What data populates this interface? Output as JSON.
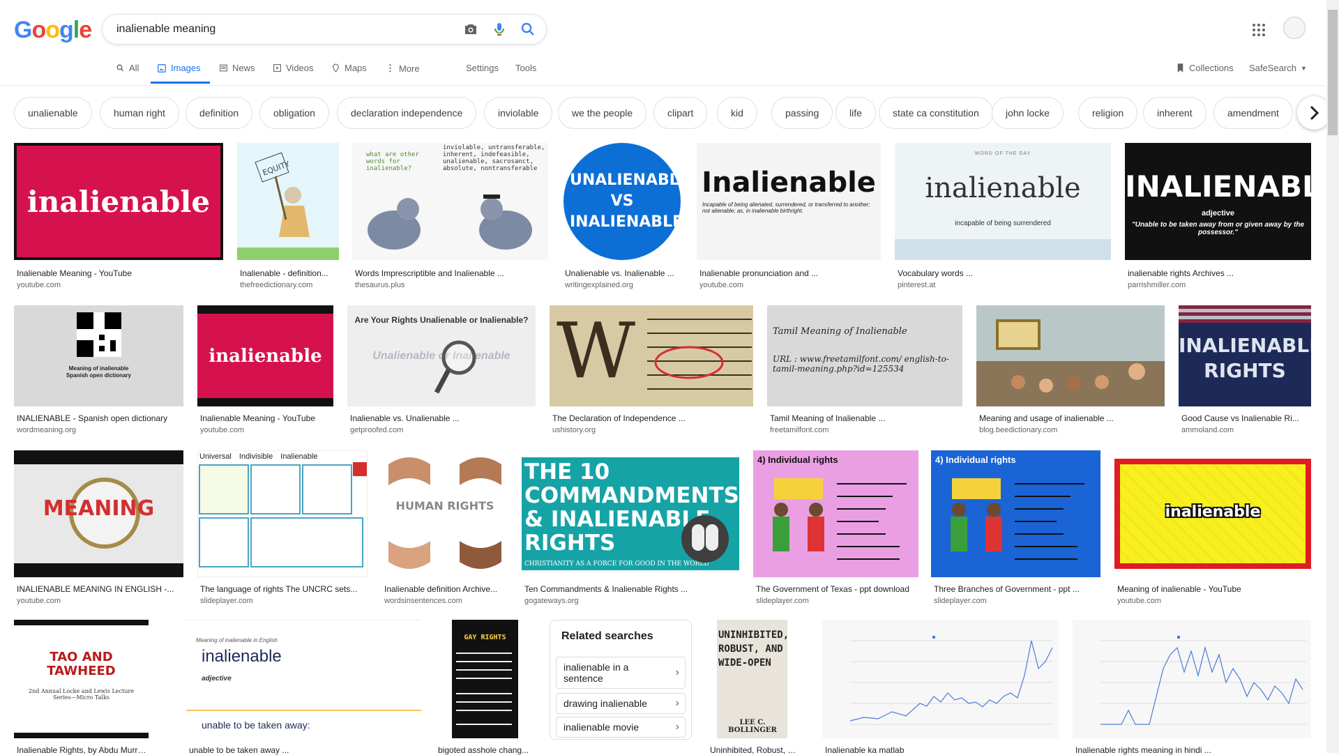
{
  "header": {
    "logo_letters": [
      "G",
      "o",
      "o",
      "g",
      "l",
      "e"
    ],
    "logo_colors": [
      "#4285f4",
      "#ea4335",
      "#fbbc05",
      "#4285f4",
      "#34a853",
      "#ea4335"
    ],
    "query": "inalienable meaning",
    "icons": [
      "camera-icon",
      "mic-icon",
      "search-icon",
      "apps-icon",
      "avatar"
    ]
  },
  "tabs": {
    "all": "All",
    "images": "Images",
    "news": "News",
    "videos": "Videos",
    "maps": "Maps",
    "more": "More",
    "settings": "Settings",
    "tools": "Tools",
    "collections": "Collections",
    "safesearch": "SafeSearch"
  },
  "chips": [
    "unalienable",
    "human right",
    "definition",
    "obligation",
    "declaration independence",
    "inviolable",
    "we the people",
    "clipart",
    "kid",
    "passing",
    "life",
    "state ca constitution",
    "john locke",
    "religion",
    "inherent",
    "amendment"
  ],
  "results": [
    {
      "caption": "Inalienable Meaning - YouTube",
      "source": "youtube.com",
      "thumb_text": "inalienable"
    },
    {
      "caption": "Inalienable - definition...",
      "source": "thefreedictionary.com",
      "thumb_text": "EQUITY"
    },
    {
      "caption": "Words Imprescriptible and Inalienable ...",
      "source": "thesaurus.plus",
      "thumb_text": "what are other words for inalienable?"
    },
    {
      "caption": "Unalienable vs. Inalienable ...",
      "source": "writingexplained.org",
      "thumb_text": "UNALIENABLE VS INALIENABLE"
    },
    {
      "caption": "Inalienable pronunciation and ...",
      "source": "youtube.com",
      "thumb_text": "Inalienable"
    },
    {
      "caption": "Vocabulary words ...",
      "source": "pinterest.at",
      "thumb_text": "inalienable"
    },
    {
      "caption": "inalienable rights Archives ...",
      "source": "parrishmiller.com",
      "thumb_text": "INALIENABLE"
    },
    {
      "caption": "INALIENABLE - Spanish open dictionary",
      "source": "wordmeaning.org",
      "thumb_text": "Meaning of inalienable"
    },
    {
      "caption": "Inalienable Meaning - YouTube",
      "source": "youtube.com",
      "thumb_text": "inalienable"
    },
    {
      "caption": "Inalienable vs. Unalienable ...",
      "source": "getproofed.com",
      "thumb_text": "Are Your Rights Unalienable or Inalienable?"
    },
    {
      "caption": "The Declaration of Independence ...",
      "source": "ushistory.org",
      "thumb_text": "W"
    },
    {
      "caption": "Tamil Meaning of Inalienable ...",
      "source": "freetamilfont.com",
      "thumb_text": "Tamil Meaning of Inalienable"
    },
    {
      "caption": "Meaning and usage of inalienable ...",
      "source": "blog.beedictionary.com",
      "thumb_text": ""
    },
    {
      "caption": "Good Cause vs Inalienable Ri...",
      "source": "ammoland.com",
      "thumb_text": "INALIENABLE RIGHTS"
    },
    {
      "caption": "INALIENABLE MEANING IN ENGLISH -...",
      "source": "youtube.com",
      "thumb_text": "MEANING"
    },
    {
      "caption": "The language of rights The UNCRC sets...",
      "source": "slideplayer.com",
      "thumb_text": "Universal Indivisible Inalienable"
    },
    {
      "caption": "Inalienable definition Archive...",
      "source": "wordsinsentences.com",
      "thumb_text": "HUMAN RIGHTS"
    },
    {
      "caption": "Ten Commandments & Inalienable Rights ...",
      "source": "gogateways.org",
      "thumb_text": "THE 10 COMMANDMENTS & INALIENABLE RIGHTS"
    },
    {
      "caption": "The Government of Texas - ppt download",
      "source": "slideplayer.com",
      "thumb_text": "4) Individual rights"
    },
    {
      "caption": "Three Branches of Government - ppt ...",
      "source": "slideplayer.com",
      "thumb_text": "4) Individual rights"
    },
    {
      "caption": "Meaning of inalienable - YouTube",
      "source": "youtube.com",
      "thumb_text": "inalienable"
    },
    {
      "caption": "Inalienable Rights, by Abdu Murray ...",
      "source": "",
      "thumb_text": "TAO AND TAWHEED"
    },
    {
      "caption": "unable to be taken away ...",
      "source": "",
      "thumb_text": "inalienable"
    },
    {
      "caption": "bigoted asshole chang...",
      "source": "",
      "thumb_text": "GAY RIGHTS"
    },
    {
      "caption": "Uninhibited, Robust, a...",
      "source": "",
      "thumb_text": "UNINHIBITED, ROBUST, AND WIDE-OPEN"
    },
    {
      "caption": "Inalienable ka matlab",
      "source": "",
      "thumb_text": ""
    },
    {
      "caption": "Inalienable rights meaning in hindi ...",
      "source": "",
      "thumb_text": ""
    }
  ],
  "related": {
    "title": "Related searches",
    "items": [
      "inalienable in a sentence",
      "drawing inalienable",
      "inalienable movie"
    ]
  },
  "extra_text": {
    "t3_sub": "inviolable, untransferable, inherent, indefeasible, unalienable, sacrosanct, absolute, nontransferable",
    "t5_sub": "Incapable of being alienated, surrendered, or transferred to another; not alienable; as, in inalienable birthright.",
    "t6_sub": "incapable of being surrendered",
    "t6_hdr": "WORD OF THE DAY",
    "t7_sub": "adjective",
    "t7_def": "\"Unable to be taken away from or given away by the possessor.\"",
    "t8_sub": "Spanish open dictionary",
    "t10_sub": "Unalienable or Inalienable",
    "t12_url": "URL : www.freetamilfont.com/ english-to-tamil-meaning.php?id=125534",
    "t18_sub": "CHRISTIANITY AS A FORCE FOR GOOD IN THE WORLD",
    "t23_pos": "adjective",
    "t23_def": "unable to be taken away:",
    "t23_hdr": "Meaning of inalienable in English",
    "t25_sub": "LEE C. BOLLINGER",
    "t22_sub": "2nd Annual Locke and Lewis Lecture Series—Micro Talks"
  }
}
